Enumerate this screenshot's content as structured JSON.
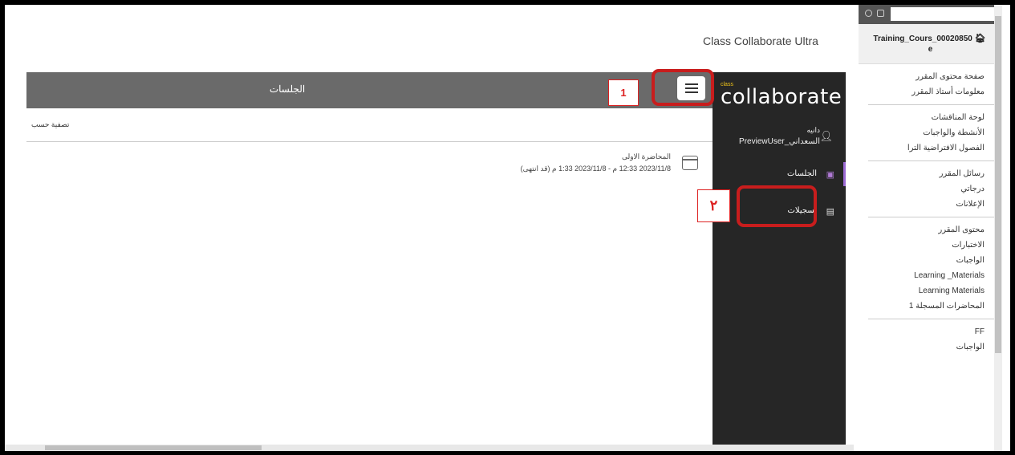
{
  "app_title": "Class Collaborate Ultra",
  "sessions_bar": {
    "title": "الجلسات"
  },
  "filter_label": "تصفية حسب",
  "session": {
    "name": "المحاضرة الاولى",
    "dates": "2023/11/8 12:33 م - 2023/11/8 1:33 م (قد انتهى)"
  },
  "collab_panel": {
    "logo_small": "class",
    "logo_text": "collaborate",
    "user_line1": "دانيه",
    "user_line2": "السعداني_PreviewUser",
    "nav_sessions": "الجلسات",
    "nav_recordings": "تسجيلات"
  },
  "annotations": {
    "n1": "1",
    "n2": "٢"
  },
  "course_menu": {
    "course_id": "Training_Cours_00020850",
    "course_id_suffix": "e",
    "groups": [
      [
        "صفحة محتوى المقرر",
        "معلومات أستاذ المقرر"
      ],
      [
        "لوحة المناقشات",
        "الأنشطة والواجبات",
        "الفصول الافتراضية الترا"
      ],
      [
        "رسائل المقرر",
        "درجاتي",
        "الإعلانات"
      ],
      [
        "محتوى المقرر",
        "الاختبارات",
        "الواجبات",
        "Learning _Materials",
        "Learning Materials",
        "المحاضرات المسجلة 1"
      ],
      [
        "FF",
        "الواجبات"
      ]
    ]
  },
  "colors": {
    "accent_red": "#c81d1d",
    "panel_bg": "#262626",
    "active_purple": "#9c6ad4"
  },
  "icons": [
    "hamburger-menu-icon",
    "calendar-icon",
    "user-icon",
    "sessions-icon",
    "recordings-icon",
    "home-icon"
  ]
}
